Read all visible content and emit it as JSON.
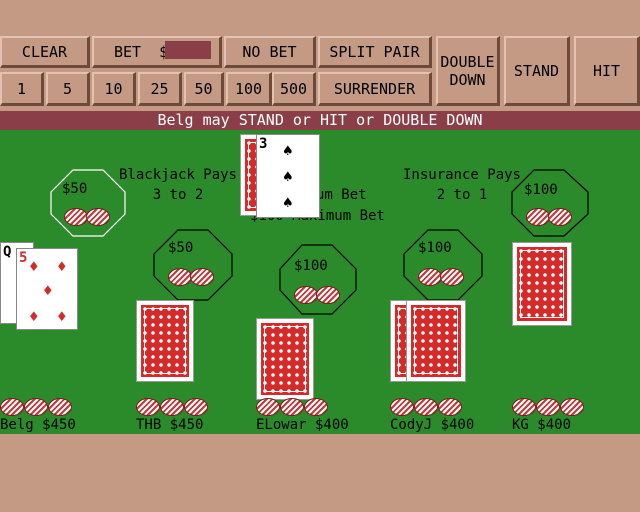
{
  "controls": {
    "row1": {
      "clear": "CLEAR",
      "bet": "BET  $",
      "no_bet": "NO BET",
      "split_pair": "SPLIT PAIR"
    },
    "double_down": "DOUBLE\nDOWN",
    "stand": "STAND",
    "hit": "HIT",
    "row2": {
      "c1": "1",
      "c5": "5",
      "c10": "10",
      "c25": "25",
      "c50": "50",
      "c100": "100",
      "c500": "500",
      "surrender": "SURRENDER"
    },
    "bet_value": ""
  },
  "status": "Belg may STAND or HIT or DOUBLE DOWN",
  "table": {
    "blackjack_pays": "Blackjack Pays\n3 to 2",
    "insurance_pays": "Insurance Pays\n2 to 1",
    "min_bet": "um Bet",
    "max_bet": "$100 Maximum Bet"
  },
  "bets": {
    "belg": "$50",
    "thb": "$50",
    "elowar": "$100",
    "codyj": "$100",
    "kg": "$100"
  },
  "players": {
    "belg": "Belg $450",
    "thb": "THB $450",
    "elowar": "ELowar $400",
    "codyj": "CodyJ $400",
    "kg": "KG $400"
  },
  "cards": {
    "dealer_up": "3",
    "dealer_suit": "♠",
    "belg_back_rank": "Q",
    "belg_front_rank": "5",
    "belg_front_suit": "♦"
  },
  "colors": {
    "table": "#2b8b2b",
    "panel": "#c49a84",
    "status_bar": "#8a3e48",
    "card_red": "#d42a2a"
  }
}
